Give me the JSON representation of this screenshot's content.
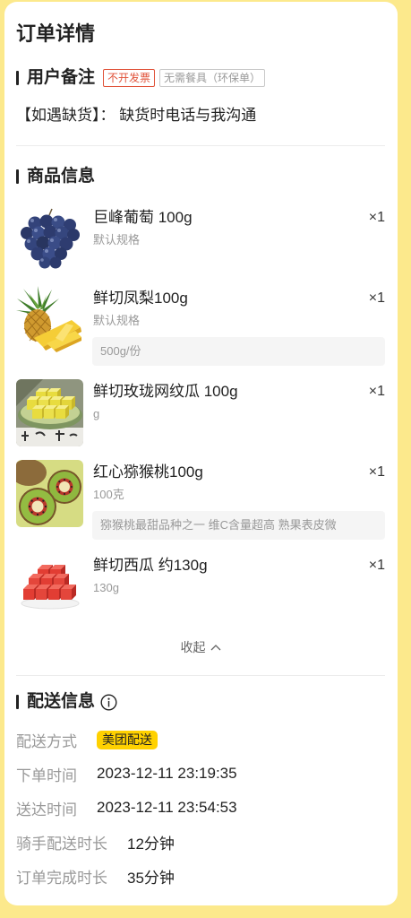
{
  "page": {
    "title": "订单详情"
  },
  "remarks": {
    "heading": "用户备注",
    "tags": [
      "不开发票",
      "无需餐具（环保单）"
    ],
    "note": "【如遇缺货】： 缺货时电话与我沟通"
  },
  "products": {
    "heading": "商品信息",
    "items": [
      {
        "name": "巨峰葡萄 100g",
        "spec": "默认规格",
        "qty": "×1",
        "image": "grapes-image"
      },
      {
        "name": "鲜切凤梨100g",
        "spec": "默认规格",
        "note": "500g/份",
        "qty": "×1",
        "image": "pineapple-image"
      },
      {
        "name": "鲜切玫珑网纹瓜 100g",
        "spec": "g",
        "qty": "×1",
        "image": "cantaloupe-image"
      },
      {
        "name": "红心猕猴桃100g",
        "spec": "100克",
        "note": "猕猴桃最甜品种之一 维C含量超高 熟果表皮微",
        "qty": "×1",
        "image": "kiwi-image"
      },
      {
        "name": "鲜切西瓜 约130g",
        "spec": "130g",
        "qty": "×1",
        "image": "watermelon-image"
      }
    ],
    "collapse_label": "收起",
    "collapse_icon": "chevron-up-icon"
  },
  "delivery": {
    "heading": "配送信息",
    "heading_icon": "info-icon",
    "method": {
      "label": "配送方式",
      "value": "美团配送"
    },
    "order_time": {
      "label": "下单时间",
      "value": "2023-12-11 23:19:35"
    },
    "arrival_time": {
      "label": "送达时间",
      "value": "2023-12-11 23:54:53"
    },
    "rider_duration": {
      "label": "骑手配送时长",
      "value": "12分钟"
    },
    "completion_duration": {
      "label": "订单完成时长",
      "value": "35分钟"
    }
  },
  "colors": {
    "background": "#fce98c",
    "card": "#ffffff",
    "badge_yellow": "#ffd100",
    "tag_red": "#e0533a",
    "text_secondary": "#999999"
  }
}
